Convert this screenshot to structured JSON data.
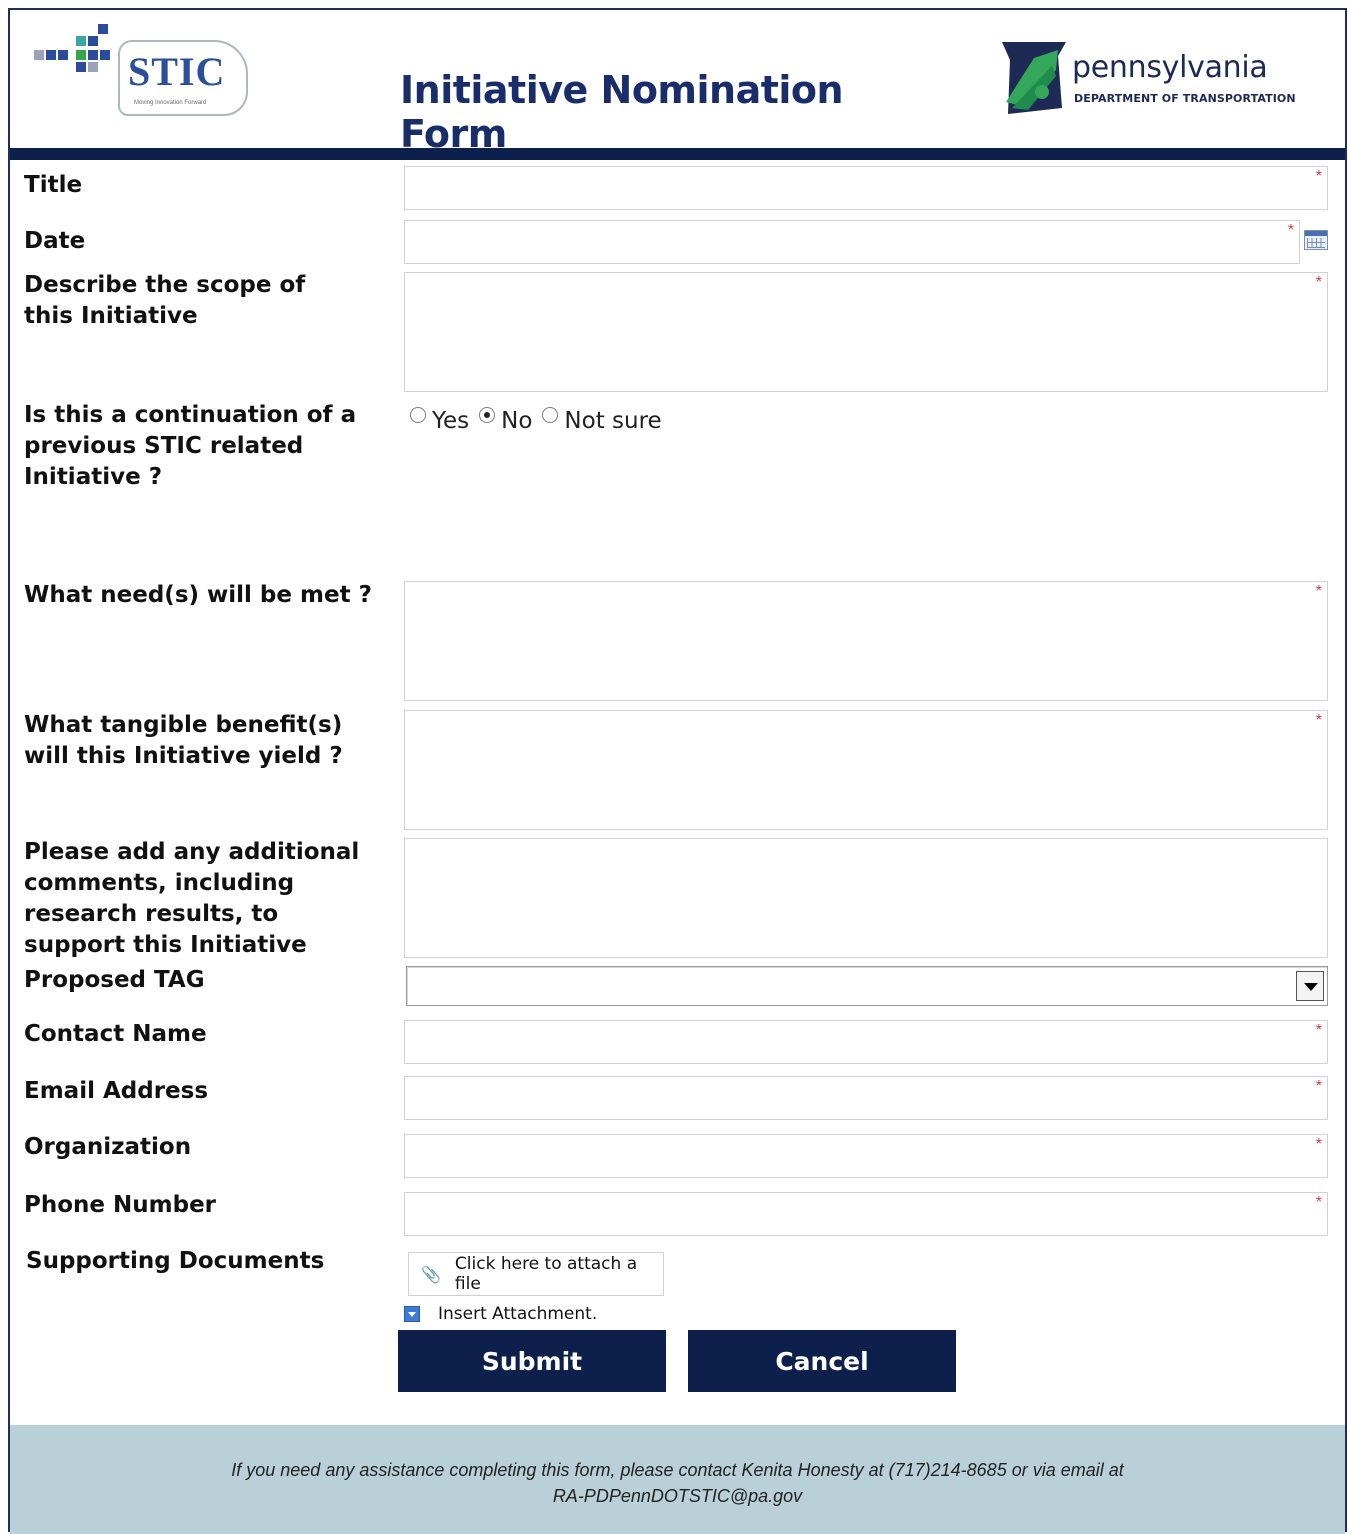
{
  "header": {
    "stic_logo_text": "STIC",
    "stic_logo_tagline": "Moving Innovation Forward",
    "title": "Initiative Nomination Form",
    "penndot_name": "pennsylvania",
    "penndot_dept": "DEPARTMENT OF TRANSPORTATION"
  },
  "fields": {
    "title_label": "Title",
    "date_label": "Date",
    "scope_label": "Describe the scope of this Initiative",
    "continuation_label": "Is this a continuation of a previous STIC related Initiative ?",
    "continuation_options": [
      "Yes",
      "No",
      "Not sure"
    ],
    "continuation_selected": "No",
    "needs_label": "What need(s) will be met ?",
    "benefits_label": "What tangible benefit(s) will this Initiative yield ?",
    "comments_label": "Please add any additional comments, including research results, to support this Initiative",
    "tag_label": "Proposed TAG",
    "contact_label": "Contact Name",
    "email_label": "Email Address",
    "org_label": "Organization",
    "phone_label": "Phone Number",
    "docs_label": "Supporting Documents",
    "required_marker": "*"
  },
  "attachments": {
    "attach_button": "Click here to attach a file",
    "insert_label": "Insert Attachment."
  },
  "actions": {
    "submit": "Submit",
    "cancel": "Cancel"
  },
  "footer": {
    "line1": "If you need any assistance completing this form, please contact Kenita Honesty at (717)214-8685 or via email at",
    "line2": "RA-PDPennDOTSTIC@pa.gov"
  },
  "colors": {
    "navy": "#0d1f4b",
    "title_blue": "#1a2d6b",
    "footer_bg": "#b9d0d8",
    "required_red": "#e03a3a"
  }
}
